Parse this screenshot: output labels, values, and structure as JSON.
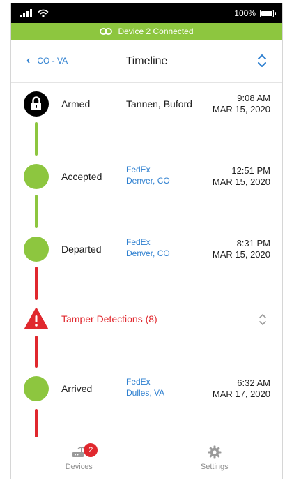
{
  "status_bar": {
    "battery_label": "100%",
    "signal_icon": "signal-bars-icon",
    "wifi_icon": "wifi-icon",
    "battery_icon": "battery-full-icon"
  },
  "banner": {
    "text": "Device 2 Connected",
    "icon": "link-icon",
    "color": "#8dc63f"
  },
  "header": {
    "back_label": "CO - VA",
    "title": "Timeline",
    "sort_icon": "sort-chevrons-icon"
  },
  "events": [
    {
      "label": "Armed",
      "party_line1": "Tannen, Buford",
      "party_line2": "",
      "time": "9:08 AM",
      "date": "MAR 15, 2020",
      "icon": "lock-icon",
      "node_color": "#000000"
    },
    {
      "label": "Accepted",
      "party_line1": "FedEx",
      "party_line2": "Denver, CO",
      "time": "12:51 PM",
      "date": "MAR 15, 2020",
      "node_color": "#8dc63f"
    },
    {
      "label": "Departed",
      "party_line1": "FedEx",
      "party_line2": "Denver, CO",
      "time": "8:31 PM",
      "date": "MAR 15, 2020",
      "node_color": "#8dc63f"
    },
    {
      "label": "Tamper Detections (8)",
      "icon": "warning-triangle-icon",
      "node_color": "#e0282e",
      "expand_icon": "expand-chevrons-icon"
    },
    {
      "label": "Arrived",
      "party_line1": "FedEx",
      "party_line2": "Dulles, VA",
      "time": "6:32 AM",
      "date": "MAR 17, 2020",
      "node_color": "#8dc63f"
    }
  ],
  "bottom_nav": {
    "devices": {
      "label": "Devices",
      "badge": "2",
      "icon": "router-icon"
    },
    "settings": {
      "label": "Settings",
      "icon": "gear-icon"
    }
  },
  "colors": {
    "accent_blue": "#2f80d0",
    "success_green": "#8dc63f",
    "alert_red": "#e0282e"
  }
}
